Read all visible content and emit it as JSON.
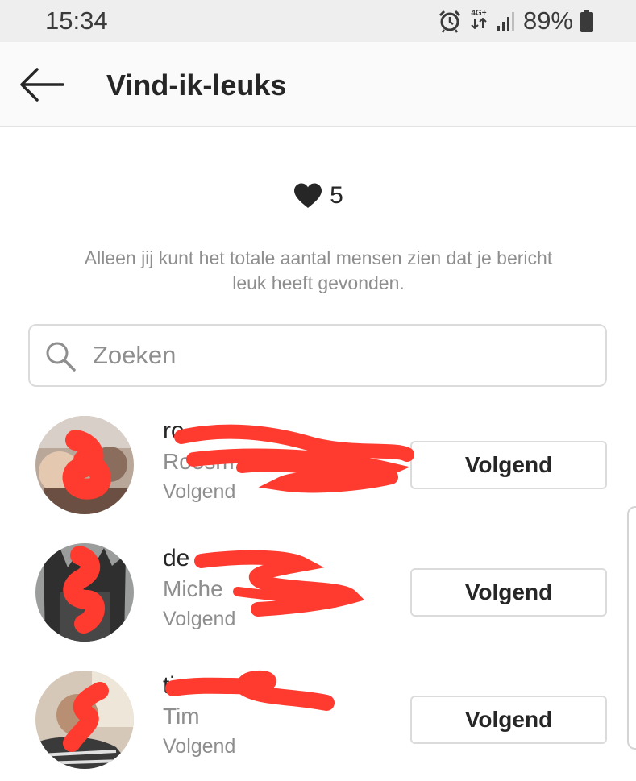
{
  "status_bar": {
    "time": "15:34",
    "network": "4G+",
    "battery": "89%",
    "icons": [
      "alarm-icon",
      "network-data-icon",
      "signal-icon",
      "battery-icon"
    ]
  },
  "header": {
    "title": "Vind-ik-leuks",
    "back_icon": "back-arrow-icon"
  },
  "likes": {
    "icon": "heart-icon",
    "count": "5"
  },
  "info_text": "Alleen jij kunt het totale aantal mensen zien dat je bericht leuk heeft gevonden.",
  "search": {
    "icon": "search-icon",
    "placeholder": "Zoeken",
    "value": ""
  },
  "users": [
    {
      "username": "ro",
      "fullname": "Roosm",
      "status": "Volgend",
      "button_label": "Volgend"
    },
    {
      "username": "de",
      "fullname": "Miche",
      "status": "Volgend",
      "button_label": "Volgend"
    },
    {
      "username": "ti",
      "fullname": "Tim",
      "status": "Volgend",
      "button_label": "Volgend"
    }
  ],
  "colors": {
    "text_primary": "#262626",
    "text_secondary": "#8e8e8e",
    "border": "#dbdbdb",
    "redaction": "#ff3b30"
  }
}
